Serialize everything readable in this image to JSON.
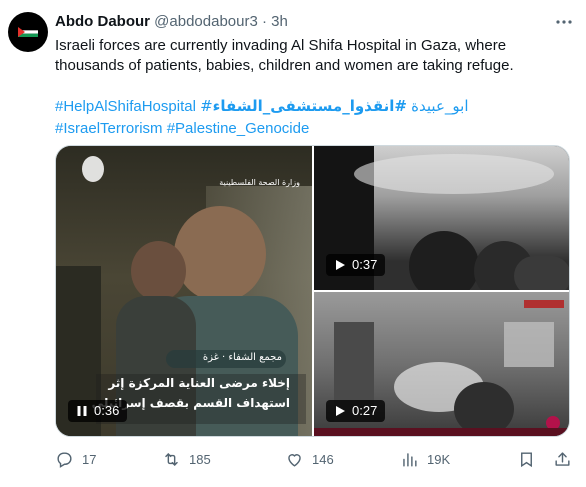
{
  "author": {
    "display_name": "Abdo Dabour",
    "handle": "@abdodabour3",
    "separator": "·",
    "time": "3h"
  },
  "tweet": {
    "text": "Israeli forces are currently invading Al Shifa Hospital in Gaza, where thousands of patients, babies, children and women are taking refuge.",
    "hashtags_line1": [
      "#HelpAlShifaHospital",
      "#ابو_عبيدة",
      "#انقذوا_مستشفى_الشفاء"
    ],
    "hashtags_line2": [
      "#IsraelTerrorism",
      "#Palestine_Genocide"
    ]
  },
  "media": {
    "videos": [
      {
        "duration": "0:36",
        "overlay_source": "وزارة الصحة الفلسطينية",
        "overlay_location": "مجمع الشفاء · غزة",
        "overlay_caption_1": "إخلاء مرضى العناية المركزة إثر",
        "overlay_caption_2": "استهداف القسم بقصف إسرائيلي"
      },
      {
        "duration": "0:37"
      },
      {
        "duration": "0:27"
      }
    ]
  },
  "actions": {
    "replies": "17",
    "reposts": "185",
    "likes": "146",
    "views": "19K"
  },
  "colors": {
    "accent": "#1d9bf0",
    "text": "#0f1419",
    "secondary": "#536471",
    "border": "#cfd9de"
  },
  "icons": {
    "avatar": "palestine-flag-icon",
    "more": "more-dots-icon",
    "play": "play-icon",
    "pause": "pause-icon",
    "reply": "reply-icon",
    "repost": "repost-icon",
    "like": "heart-icon",
    "views": "views-chart-icon",
    "bookmark": "bookmark-icon",
    "share": "share-icon"
  }
}
